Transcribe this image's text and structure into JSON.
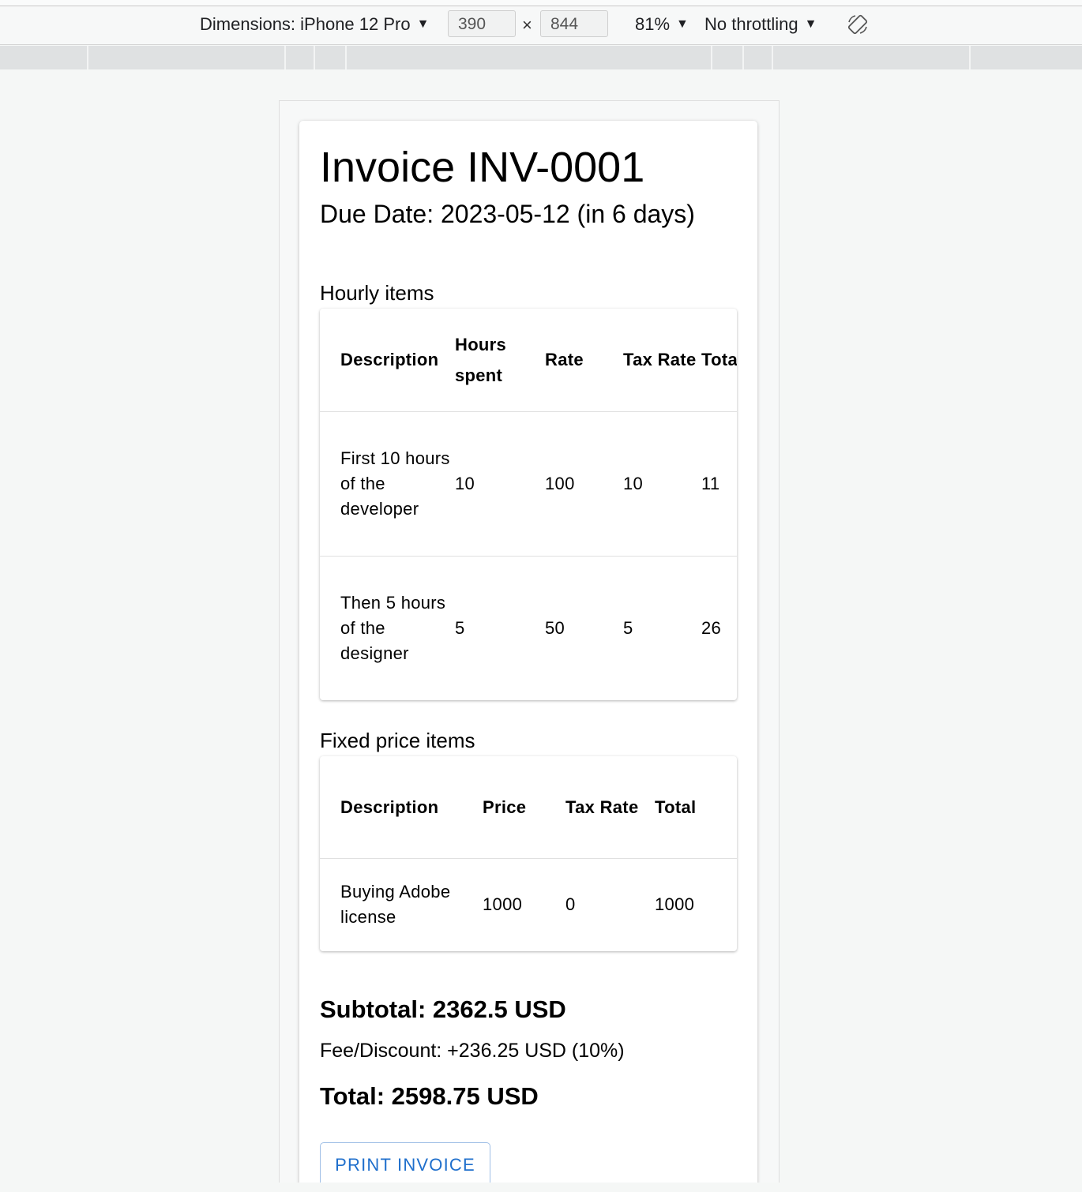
{
  "devtools": {
    "dimensions_label": "Dimensions: iPhone 12 Pro",
    "width_value": "390",
    "height_value": "844",
    "times_symbol": "×",
    "zoom": "81%",
    "throttling": "No throttling",
    "caret": "▼"
  },
  "invoice": {
    "title": "Invoice INV-0001",
    "due_date": "Due Date: 2023-05-12 (in 6 days)"
  },
  "hourly": {
    "label": "Hourly items",
    "headers": [
      "Description",
      "Hours spent",
      "Rate",
      "Tax Rate",
      "Total"
    ],
    "rows": [
      {
        "description": "First 10 hours of the developer",
        "hours": "10",
        "rate": "100",
        "tax": "10",
        "total": "11"
      },
      {
        "description": "Then 5 hours of the designer",
        "hours": "5",
        "rate": "50",
        "tax": "5",
        "total": "26"
      }
    ]
  },
  "fixed": {
    "label": "Fixed price items",
    "headers": [
      "Description",
      "Price",
      "Tax Rate",
      "Total"
    ],
    "rows": [
      {
        "description": "Buying Adobe license",
        "price": "1000",
        "tax": "0",
        "total": "1000"
      }
    ]
  },
  "summary": {
    "subtotal": "Subtotal: 2362.5 USD",
    "fee": "Fee/Discount: +236.25 USD (10%)",
    "total": "Total: 2598.75 USD"
  },
  "actions": {
    "print_label": "PRINT INVOICE"
  },
  "colors": {
    "accent": "#1f6fcc",
    "page_background": "#f5f7f6"
  }
}
